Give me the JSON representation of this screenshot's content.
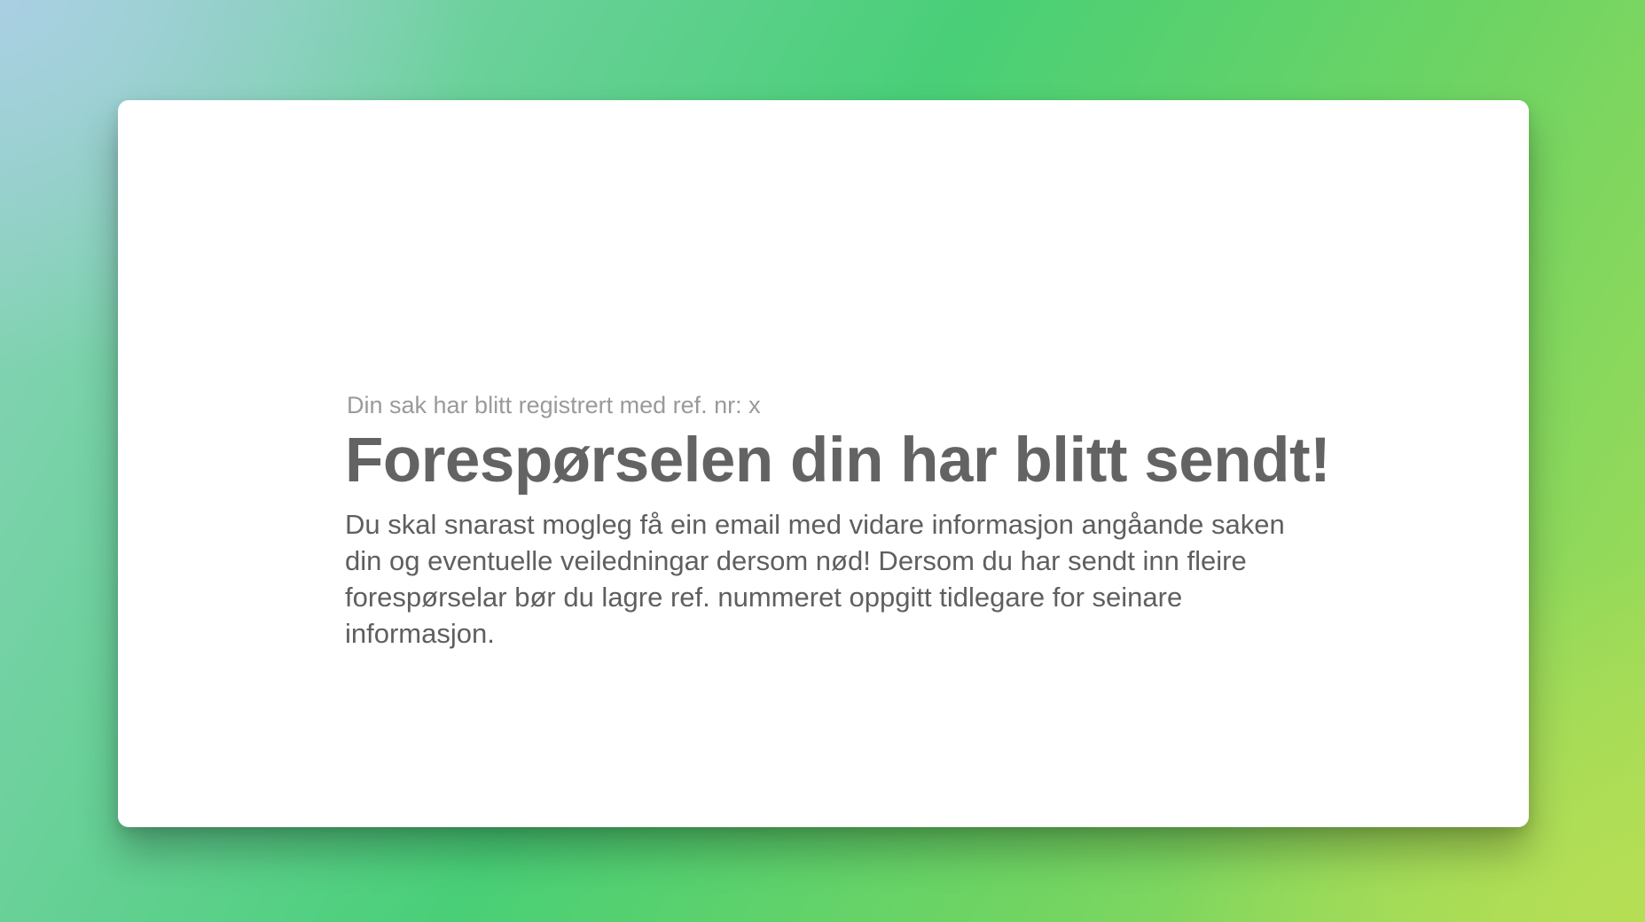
{
  "confirmation": {
    "reference_line": "Din sak har blitt registrert med ref. nr: x",
    "title": "Forespørselen din har blitt sendt!",
    "message": "Du skal snarast mogleg få ein email med vidare informasjon angåande saken din og eventuelle veiledningar dersom nød! Dersom du har sendt inn fleire forespørselar bør du lagre ref. nummeret oppgitt tidlegare for seinare informasjon."
  },
  "colors": {
    "card_background": "#ffffff",
    "title_text": "#636363",
    "ref_text": "#9a9a9a",
    "background_gradient": [
      "#a9cfe3",
      "#49cf77",
      "#b6de55"
    ]
  }
}
